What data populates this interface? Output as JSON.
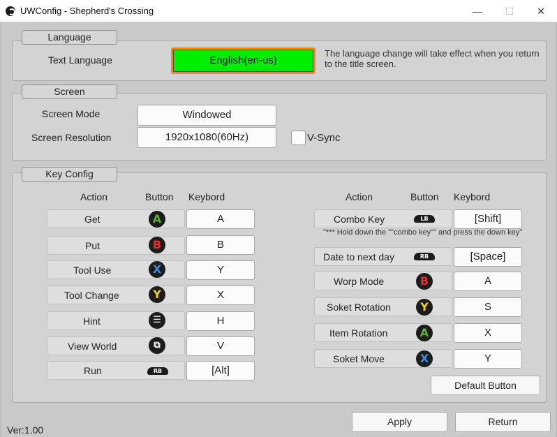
{
  "window": {
    "title": "UWConfig - Shepherd's Crossing",
    "minimize": "—",
    "maximize": "☐",
    "close": "✕"
  },
  "language": {
    "section_title": "Language",
    "text_language_label": "Text Language",
    "selected_language": "English(en-us)",
    "note": "The language change will take effect when you return to the title screen.",
    "accent_color": "#ee8a1c",
    "selected_color": "#00ee00"
  },
  "screen": {
    "section_title": "Screen",
    "mode_label": "Screen Mode",
    "mode_value": "Windowed",
    "resolution_label": "Screen Resolution",
    "resolution_value": "1920x1080(60Hz)",
    "vsync_label": "V-Sync",
    "vsync_checked": false
  },
  "key_config": {
    "section_title": "Key Config",
    "headers": {
      "action": "Action",
      "button": "Button",
      "keyboard": "Keybord"
    },
    "left_rows": [
      {
        "action": "Get",
        "button": "A",
        "button_type": "a-button-icon",
        "key": "A"
      },
      {
        "action": "Put",
        "button": "B",
        "button_type": "b-button-icon",
        "key": "B"
      },
      {
        "action": "Tool Use",
        "button": "X",
        "button_type": "x-button-icon",
        "key": "Y"
      },
      {
        "action": "Tool Change",
        "button": "Y",
        "button_type": "y-button-icon",
        "key": "X"
      },
      {
        "action": "Hint",
        "button": "☰",
        "button_type": "menu-button-icon",
        "key": "H"
      },
      {
        "action": "View World",
        "button": "⧉",
        "button_type": "view-button-icon",
        "key": "V"
      },
      {
        "action": "Run",
        "button": "RB",
        "button_type": "rb-bumper-icon",
        "key": "[Alt]"
      }
    ],
    "right_rows": [
      {
        "action": "Combo Key",
        "button": "LB",
        "button_type": "lb-bumper-icon",
        "key": "[Shift]"
      },
      {
        "action": "Date to next day",
        "button": "RB",
        "button_type": "rb-bumper-icon",
        "key": "[Space]"
      },
      {
        "action": "Worp Mode",
        "button": "B",
        "button_type": "b-button-icon",
        "key": "A"
      },
      {
        "action": "Soket Rotation",
        "button": "Y",
        "button_type": "y-button-icon",
        "key": "S"
      },
      {
        "action": "Item Rotation",
        "button": "A",
        "button_type": "a-button-icon",
        "key": "X"
      },
      {
        "action": "Soket Move",
        "button": "X",
        "button_type": "x-button-icon",
        "key": "Y"
      }
    ],
    "combo_hint": "\"*** Hold down the \"\"combo key\"\" and press the down key\"",
    "default_button": "Default Button",
    "button_colors": {
      "A": "#5db02e",
      "B": "#e2312b",
      "X": "#3d8fe0",
      "Y": "#f0d21f"
    }
  },
  "footer": {
    "version": "Ver:1.00",
    "apply": "Apply",
    "return": "Return"
  }
}
